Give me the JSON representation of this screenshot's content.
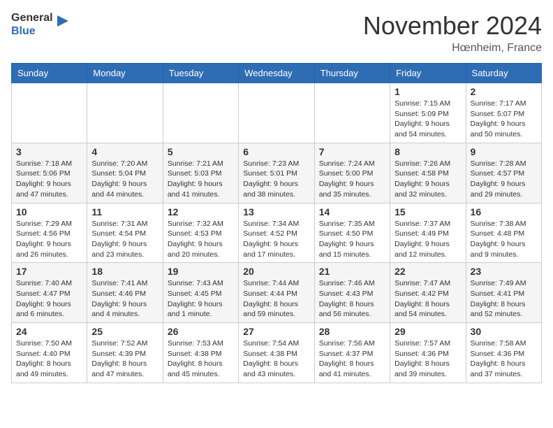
{
  "header": {
    "logo_general": "General",
    "logo_blue": "Blue",
    "month_title": "November 2024",
    "location": "Hœnheim, France"
  },
  "weekdays": [
    "Sunday",
    "Monday",
    "Tuesday",
    "Wednesday",
    "Thursday",
    "Friday",
    "Saturday"
  ],
  "weeks": [
    [
      {
        "day": "",
        "info": ""
      },
      {
        "day": "",
        "info": ""
      },
      {
        "day": "",
        "info": ""
      },
      {
        "day": "",
        "info": ""
      },
      {
        "day": "",
        "info": ""
      },
      {
        "day": "1",
        "info": "Sunrise: 7:15 AM\nSunset: 5:09 PM\nDaylight: 9 hours and 54 minutes."
      },
      {
        "day": "2",
        "info": "Sunrise: 7:17 AM\nSunset: 5:07 PM\nDaylight: 9 hours and 50 minutes."
      }
    ],
    [
      {
        "day": "3",
        "info": "Sunrise: 7:18 AM\nSunset: 5:06 PM\nDaylight: 9 hours and 47 minutes."
      },
      {
        "day": "4",
        "info": "Sunrise: 7:20 AM\nSunset: 5:04 PM\nDaylight: 9 hours and 44 minutes."
      },
      {
        "day": "5",
        "info": "Sunrise: 7:21 AM\nSunset: 5:03 PM\nDaylight: 9 hours and 41 minutes."
      },
      {
        "day": "6",
        "info": "Sunrise: 7:23 AM\nSunset: 5:01 PM\nDaylight: 9 hours and 38 minutes."
      },
      {
        "day": "7",
        "info": "Sunrise: 7:24 AM\nSunset: 5:00 PM\nDaylight: 9 hours and 35 minutes."
      },
      {
        "day": "8",
        "info": "Sunrise: 7:26 AM\nSunset: 4:58 PM\nDaylight: 9 hours and 32 minutes."
      },
      {
        "day": "9",
        "info": "Sunrise: 7:28 AM\nSunset: 4:57 PM\nDaylight: 9 hours and 29 minutes."
      }
    ],
    [
      {
        "day": "10",
        "info": "Sunrise: 7:29 AM\nSunset: 4:56 PM\nDaylight: 9 hours and 26 minutes."
      },
      {
        "day": "11",
        "info": "Sunrise: 7:31 AM\nSunset: 4:54 PM\nDaylight: 9 hours and 23 minutes."
      },
      {
        "day": "12",
        "info": "Sunrise: 7:32 AM\nSunset: 4:53 PM\nDaylight: 9 hours and 20 minutes."
      },
      {
        "day": "13",
        "info": "Sunrise: 7:34 AM\nSunset: 4:52 PM\nDaylight: 9 hours and 17 minutes."
      },
      {
        "day": "14",
        "info": "Sunrise: 7:35 AM\nSunset: 4:50 PM\nDaylight: 9 hours and 15 minutes."
      },
      {
        "day": "15",
        "info": "Sunrise: 7:37 AM\nSunset: 4:49 PM\nDaylight: 9 hours and 12 minutes."
      },
      {
        "day": "16",
        "info": "Sunrise: 7:38 AM\nSunset: 4:48 PM\nDaylight: 9 hours and 9 minutes."
      }
    ],
    [
      {
        "day": "17",
        "info": "Sunrise: 7:40 AM\nSunset: 4:47 PM\nDaylight: 9 hours and 6 minutes."
      },
      {
        "day": "18",
        "info": "Sunrise: 7:41 AM\nSunset: 4:46 PM\nDaylight: 9 hours and 4 minutes."
      },
      {
        "day": "19",
        "info": "Sunrise: 7:43 AM\nSunset: 4:45 PM\nDaylight: 9 hours and 1 minute."
      },
      {
        "day": "20",
        "info": "Sunrise: 7:44 AM\nSunset: 4:44 PM\nDaylight: 8 hours and 59 minutes."
      },
      {
        "day": "21",
        "info": "Sunrise: 7:46 AM\nSunset: 4:43 PM\nDaylight: 8 hours and 56 minutes."
      },
      {
        "day": "22",
        "info": "Sunrise: 7:47 AM\nSunset: 4:42 PM\nDaylight: 8 hours and 54 minutes."
      },
      {
        "day": "23",
        "info": "Sunrise: 7:49 AM\nSunset: 4:41 PM\nDaylight: 8 hours and 52 minutes."
      }
    ],
    [
      {
        "day": "24",
        "info": "Sunrise: 7:50 AM\nSunset: 4:40 PM\nDaylight: 8 hours and 49 minutes."
      },
      {
        "day": "25",
        "info": "Sunrise: 7:52 AM\nSunset: 4:39 PM\nDaylight: 8 hours and 47 minutes."
      },
      {
        "day": "26",
        "info": "Sunrise: 7:53 AM\nSunset: 4:38 PM\nDaylight: 8 hours and 45 minutes."
      },
      {
        "day": "27",
        "info": "Sunrise: 7:54 AM\nSunset: 4:38 PM\nDaylight: 8 hours and 43 minutes."
      },
      {
        "day": "28",
        "info": "Sunrise: 7:56 AM\nSunset: 4:37 PM\nDaylight: 8 hours and 41 minutes."
      },
      {
        "day": "29",
        "info": "Sunrise: 7:57 AM\nSunset: 4:36 PM\nDaylight: 8 hours and 39 minutes."
      },
      {
        "day": "30",
        "info": "Sunrise: 7:58 AM\nSunset: 4:36 PM\nDaylight: 8 hours and 37 minutes."
      }
    ]
  ]
}
